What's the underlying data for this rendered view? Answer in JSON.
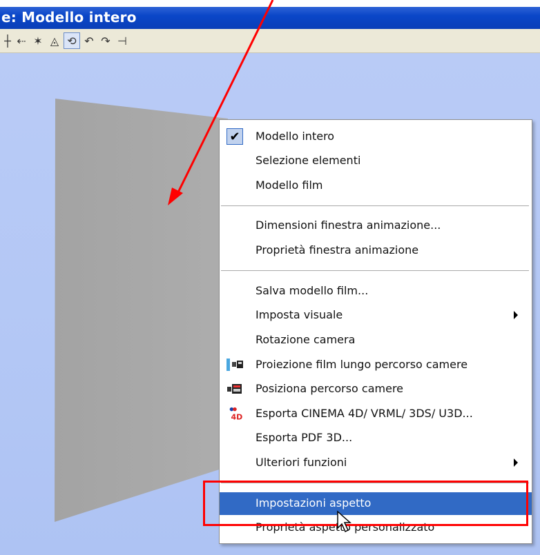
{
  "window": {
    "title": "e: Modello intero"
  },
  "toolbar": {
    "icons": [
      "pan-icon",
      "arrow-left-icon",
      "select-icon",
      "view-icon",
      "orbit-icon",
      "undo-icon",
      "redo-icon",
      "pin-icon"
    ]
  },
  "context_menu": {
    "items": [
      {
        "label": "Modello intero",
        "checked": true
      },
      {
        "label": "Selezione elementi"
      },
      {
        "label": "Modello film"
      },
      {
        "label": "Dimensioni finestra animazione..."
      },
      {
        "label": "Proprietà finestra animazione"
      },
      {
        "label": "Salva modello film..."
      },
      {
        "label": "Imposta visuale",
        "submenu": true
      },
      {
        "label": "Rotazione camera"
      },
      {
        "label": "Proiezione film lungo percorso camere",
        "icon": "film-projection-icon"
      },
      {
        "label": "Posiziona percorso camere",
        "icon": "camera-path-icon"
      },
      {
        "label": "Esporta CINEMA 4D/ VRML/ 3DS/ U3D...",
        "icon": "cinema4d-icon"
      },
      {
        "label": "Esporta PDF 3D..."
      },
      {
        "label": "Ulteriori funzioni",
        "submenu": true
      },
      {
        "label": "Impostazioni aspetto",
        "highlighted": true
      },
      {
        "label": "Proprietà aspetto personalizzato"
      }
    ]
  },
  "colors": {
    "title_bar": "#0a46c8",
    "viewport_bg": "#b3c7f5",
    "menu_highlight": "#316ac5",
    "annotation_red": "#ff0000",
    "wall_gray": "#a7a7a7"
  }
}
